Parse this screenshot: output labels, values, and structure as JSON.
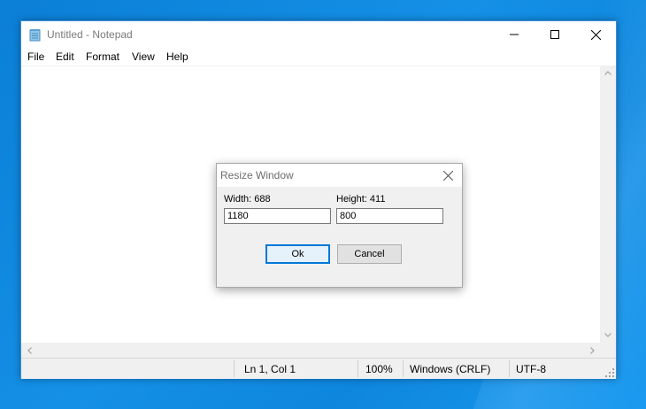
{
  "window": {
    "title": "Untitled - Notepad",
    "icon": "notepad-icon",
    "controls": [
      "minimize-icon",
      "maximize-icon",
      "close-icon"
    ]
  },
  "menu": {
    "items": [
      "File",
      "Edit",
      "Format",
      "View",
      "Help"
    ]
  },
  "editor": {
    "content": ""
  },
  "status": {
    "position": "Ln 1, Col 1",
    "zoom": "100%",
    "line_endings": "Windows (CRLF)",
    "encoding": "UTF-8"
  },
  "dialog": {
    "title": "Resize Window",
    "width_label": "Width: 688",
    "height_label": "Height: 411",
    "width_value": "1180",
    "height_value": "800",
    "ok_label": "Ok",
    "cancel_label": "Cancel"
  },
  "colors": {
    "desktop": "#0b7fd6",
    "window_border": "#3c8fd6",
    "primary_button_border": "#0078d7"
  }
}
